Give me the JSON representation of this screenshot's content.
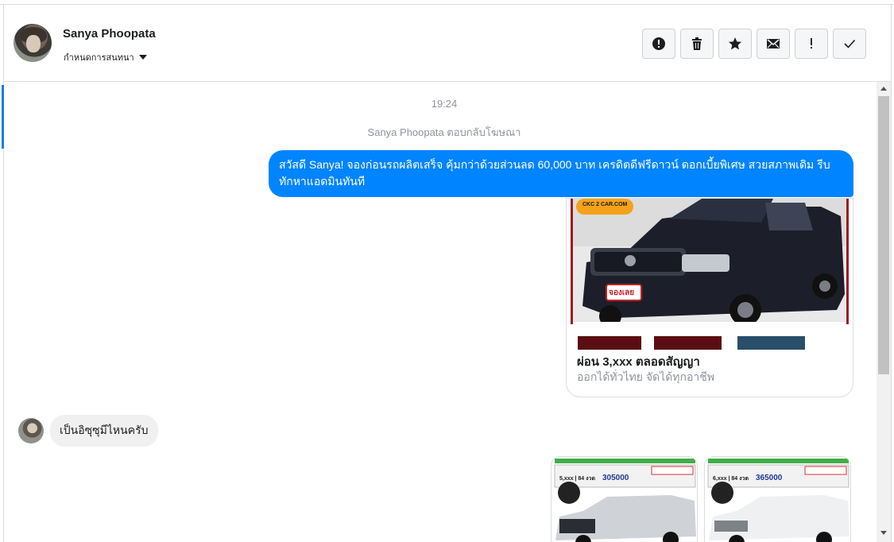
{
  "header": {
    "name": "Sanya Phoopata",
    "subtitle": "กำหนดการสนทนา",
    "actions": [
      {
        "icon": "alert-circle-icon",
        "name": "report-button"
      },
      {
        "icon": "trash-icon",
        "name": "delete-button"
      },
      {
        "icon": "star-icon",
        "name": "star-button"
      },
      {
        "icon": "mail-icon",
        "name": "mark-unread-button"
      },
      {
        "icon": "exclamation-icon",
        "name": "flag-button"
      },
      {
        "icon": "check-icon",
        "name": "mark-done-button"
      }
    ]
  },
  "conversation": {
    "time": "19:24",
    "reply_note": "Sanya Phoopata ตอบกลับโฆษณา",
    "outgoing_message": "สวัสดี Sanya! จองก่อนรถผลิตเสร็จ คุ้มกว่าด้วยส่วนลด 60,000 บาท เครดิตดีฟรีดาวน์ ดอกเบี้ยพิเศษ สวยสภาพเดิม รีบทักหาแอดมินทันที",
    "ad_card": {
      "title": "ผ่อน 3,xxx ตลอดสัญญา",
      "subtitle": "ออกได้ทั่วไทย จัดได้ทุกอาชีพ",
      "image_logo": "CKC 2 CAR.COM",
      "image_badge": "จองเลย"
    },
    "incoming_message": "เป็นอิซุซุมีไหนครับ",
    "thumbnails": [
      {
        "price": "305000",
        "installment": "5,xxx | 84 งวด"
      },
      {
        "price": "365000",
        "installment": "6,xxx | 84 งวด"
      }
    ]
  },
  "colors": {
    "accent": "#0084ff",
    "incoming_bubble": "#f1f0f0",
    "muted_text": "#90949c"
  }
}
